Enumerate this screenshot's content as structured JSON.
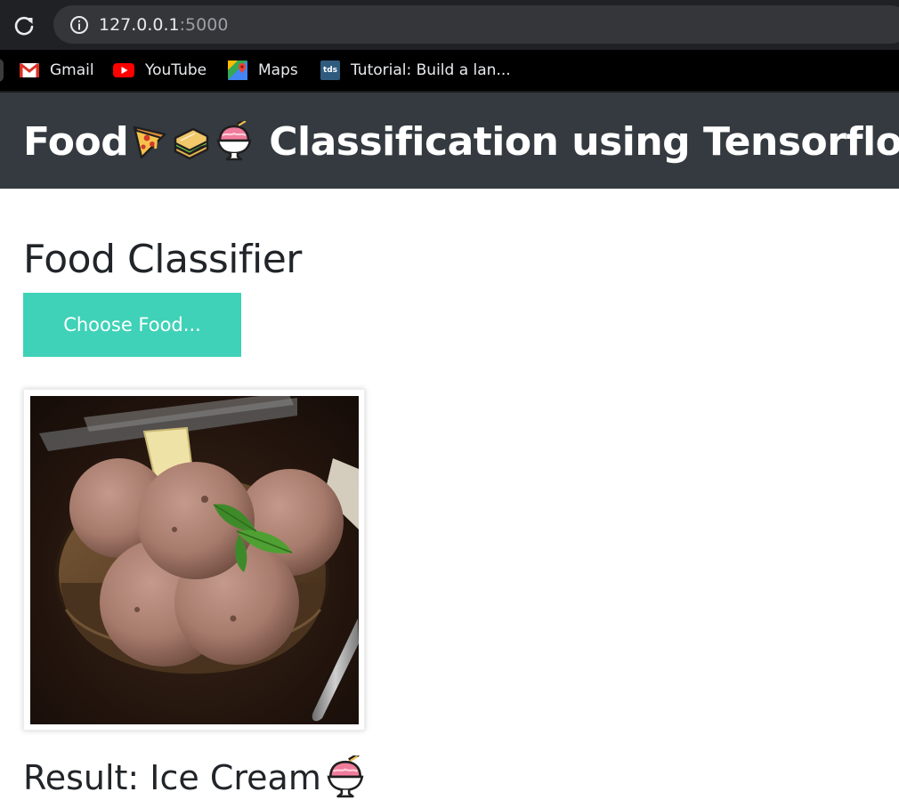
{
  "browser": {
    "url_host": "127.0.0.1",
    "url_port": ":5000",
    "bookmarks": [
      {
        "label": "Gmail",
        "icon": "gmail-icon"
      },
      {
        "label": "YouTube",
        "icon": "youtube-icon"
      },
      {
        "label": "Maps",
        "icon": "maps-icon"
      },
      {
        "label": "Tutorial: Build a lan...",
        "icon": "tds-icon",
        "icon_text": "tds"
      }
    ]
  },
  "header": {
    "title_prefix": "Food",
    "title_suffix": "Classification using Tensorflow",
    "emojis": [
      "pizza-emoji",
      "sandwich-emoji",
      "shaved-ice-emoji"
    ],
    "background": "#343a40"
  },
  "classifier": {
    "heading": "Food Classifier",
    "choose_button": "Choose Food...",
    "button_color": "#3fd2b8",
    "result_label": "Result: Ice Cream",
    "result_emoji": "shaved-ice-emoji",
    "preview_image": "chocolate-ice-cream-bowl"
  }
}
